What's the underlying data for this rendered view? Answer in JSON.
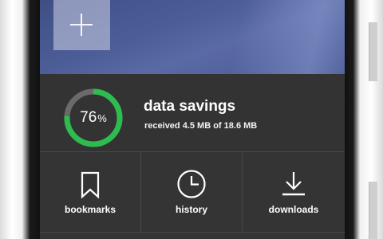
{
  "savings": {
    "percent": 76,
    "percent_value": "76",
    "percent_symbol": "%",
    "title": "data savings",
    "subtitle": "received 4.5 MB of 18.6 MB",
    "ring_color": "#2dbd4e",
    "track_color": "#6a6a6a"
  },
  "tiles": {
    "bookmarks": {
      "label": "bookmarks",
      "icon": "bookmark-icon"
    },
    "history": {
      "label": "history",
      "icon": "clock-icon"
    },
    "downloads": {
      "label": "downloads",
      "icon": "download-icon"
    }
  },
  "colors": {
    "screen_bg": "#333333",
    "wallpaper": "#4b5b96"
  }
}
